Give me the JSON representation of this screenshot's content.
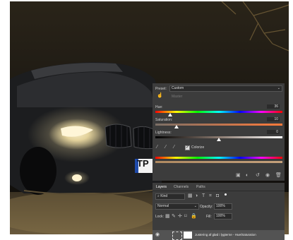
{
  "photo": {
    "plate_text": "TP"
  },
  "properties": {
    "preset_label": "Preset:",
    "preset_value": "Custom",
    "channel_value": "Master",
    "hue": {
      "label": "Hue:",
      "value": "36"
    },
    "saturation": {
      "label": "Saturation:",
      "value": "10"
    },
    "lightness": {
      "label": "Lightness:",
      "value": "0"
    },
    "colorize_label": "Colorize",
    "colorize_checked": true
  },
  "layers": {
    "tabs": [
      "Layers",
      "Channels",
      "Paths"
    ],
    "kind_label": "Kind",
    "blend_mode": "Normal",
    "opacity_label": "Opacity:",
    "opacity_value": "100%",
    "lock_label": "Lock:",
    "fill_label": "Fill:",
    "fill_value": "100%",
    "layer_name": "Justering af glød i lygterne - Hue/Saturation"
  },
  "colors": {
    "panel_bg": "#3c3c3c",
    "field_bg": "#2b2b2b",
    "selected_row": "#535353"
  }
}
